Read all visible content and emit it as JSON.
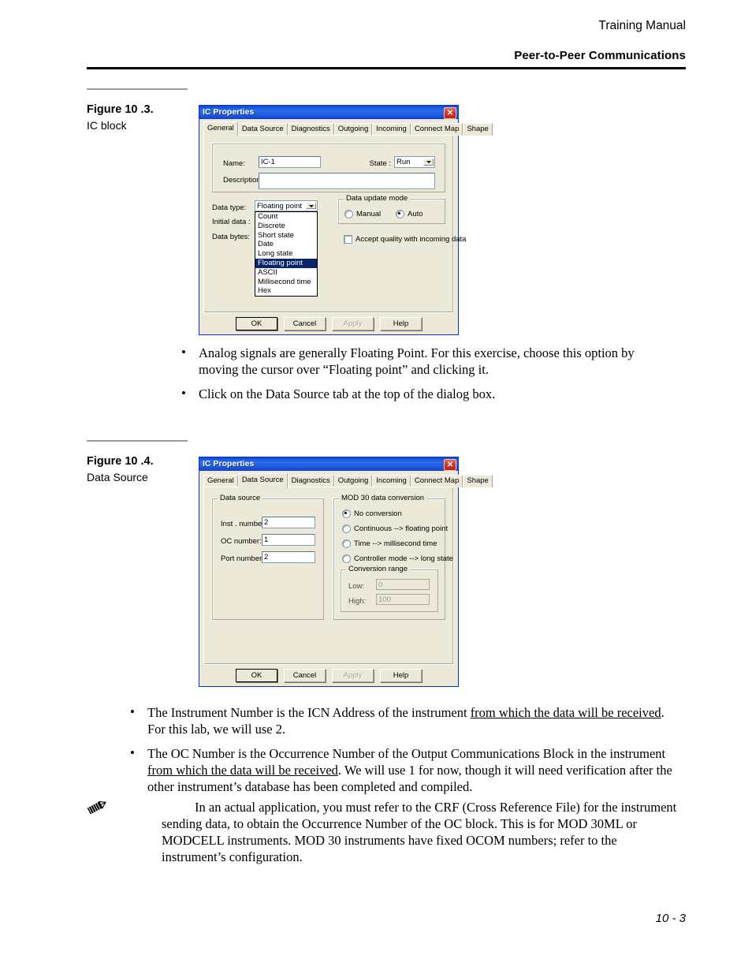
{
  "header": {
    "manual_title": "Training Manual",
    "section_title": "Peer-to-Peer Communications"
  },
  "figure_10_3": {
    "caption_title": "Figure 10 .3.",
    "caption_sub": "IC block",
    "dialog": {
      "title": "IC Properties",
      "close_label": "✕",
      "tabs": [
        "General",
        "Data Source",
        "Diagnostics",
        "Outgoing",
        "Incoming",
        "Connect Map",
        "Shape"
      ],
      "active_tab": "General",
      "general": {
        "name_label": "Name:",
        "name_value": "IC-1",
        "state_label": "State :",
        "state_value": "Run",
        "description_label": "Description:",
        "description_value": "",
        "data_type_label": "Data type:",
        "data_type_value": "Floating point",
        "initial_data_label": "Initial data :",
        "data_bytes_label": "Data bytes:",
        "data_type_options": [
          "Count",
          "Discrete",
          "Short state",
          "Date",
          "Long state",
          "Floating point",
          "ASCII",
          "Millisecond time",
          "Hex"
        ],
        "data_type_selected": "Floating point",
        "update_mode_group": "Data update mode",
        "update_manual": "Manual",
        "update_auto": "Auto",
        "update_selected": "Auto",
        "accept_quality_label": "Accept quality with incoming data",
        "accept_quality_checked": false
      },
      "buttons": {
        "ok": "OK",
        "cancel": "Cancel",
        "apply": "Apply",
        "help": "Help",
        "apply_disabled": true
      }
    }
  },
  "bullets_after_10_3": [
    "Analog signals are generally Floating Point.  For this exercise, choose this option by moving the cursor over “Floating point” and clicking it.",
    "Click on the Data Source tab at the top of the dialog box."
  ],
  "figure_10_4": {
    "caption_title": "Figure 10 .4.",
    "caption_sub": "Data Source",
    "dialog": {
      "title": "IC Properties",
      "close_label": "✕",
      "tabs": [
        "General",
        "Data Source",
        "Diagnostics",
        "Outgoing",
        "Incoming",
        "Connect Map",
        "Shape"
      ],
      "active_tab": "Data Source",
      "data_source": {
        "group_label": "Data source",
        "inst_number_label": "Inst . number:",
        "inst_number_value": "2",
        "oc_number_label": "OC number:",
        "oc_number_value": "1",
        "port_number_label": "Port number:",
        "port_number_value": "2",
        "conversion_group_label": "MOD 30 data conversion",
        "conversion_options": [
          "No conversion",
          "Continuous --> floating point",
          "Time --> millisecond time",
          "Controller mode --> long state"
        ],
        "conversion_selected": "No conversion",
        "range_group_label": "Conversion range",
        "low_label": "Low:",
        "low_value": "0",
        "high_label": "High:",
        "high_value": "100",
        "range_disabled": true
      },
      "buttons": {
        "ok": "OK",
        "cancel": "Cancel",
        "apply": "Apply",
        "help": "Help",
        "apply_disabled": true
      }
    }
  },
  "bullets_after_10_4": [
    {
      "parts": [
        {
          "text": "The Instrument Number is the ICN Address of the instrument ",
          "underline": false
        },
        {
          "text": "from which the data will be received",
          "underline": true
        },
        {
          "text": ".  For this lab, we will use 2.",
          "underline": false
        }
      ]
    },
    {
      "parts": [
        {
          "text": "The OC Number is the Occurrence Number of the Output Communications Block in the instrument ",
          "underline": false
        },
        {
          "text": "from which the data will be received",
          "underline": true
        },
        {
          "text": ".  We will use 1 for now, though it will need verification after the other instrument’s database has been completed and compiled.",
          "underline": false
        }
      ]
    }
  ],
  "note": {
    "icon": "pencil-icon",
    "text": "In an actual application, you must refer to the CRF (Cross Reference File) for the instrument sending data, to obtain the Occurrence Number of the OC block.  This is for MOD 30ML or MODCELL instruments.  MOD 30 instruments have fixed OCOM numbers; refer to the instrument’s configuration."
  },
  "footer": {
    "page_number": "10 - 3"
  },
  "colors": {
    "title_bar_blue": "#1755e0",
    "dialog_face": "#ece9d8",
    "selection_blue": "#0a246a",
    "close_red": "#d6392a"
  }
}
